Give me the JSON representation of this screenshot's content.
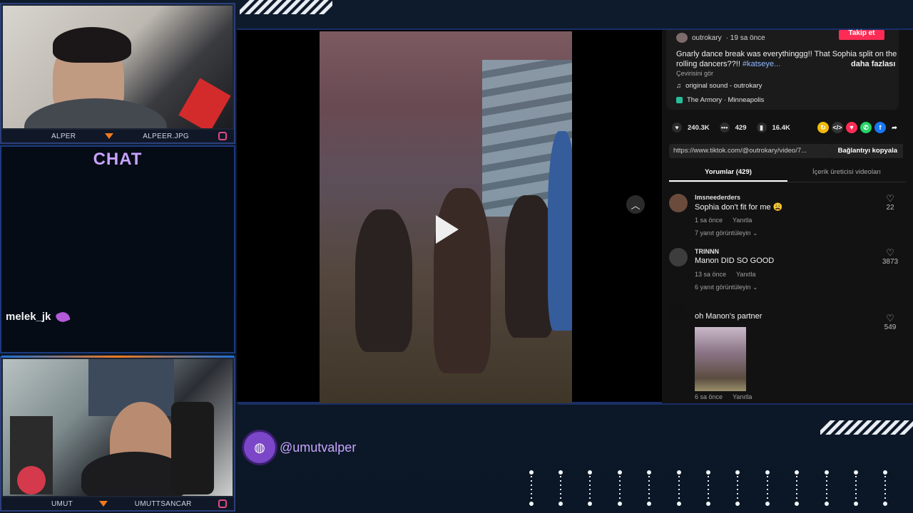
{
  "overlay": {
    "cam_top": {
      "left_name": "ALPER",
      "right_name": "ALPEER.JPG"
    },
    "cam_bottom": {
      "left_name": "UMUT",
      "right_name": "UMUTTSANCAR"
    },
    "chat": {
      "title": "CHAT",
      "message_user": "melek_jk"
    },
    "handle": "@umutvalper"
  },
  "tiktok": {
    "author": "outrokary",
    "posted": "· 19 sa önce",
    "follow_label": "Takip et",
    "caption": "Gnarly dance break was everythinggg!! That Sophia split on the rolling dancers??!! ",
    "caption_tag": "#katseye...",
    "more_label": "daha fazlası",
    "translate_label": "Çevirisini gör",
    "sound": "original sound - outrokary",
    "location": "The Armory · Minneapolis",
    "likes": "240.3K",
    "comments_count": "429",
    "saves": "16.4K",
    "link": "https://www.tiktok.com/@outrokary/video/7...",
    "copy_label": "Bağlantıyı kopyala",
    "tabs": [
      "Yorumlar (429)",
      "İçerik üreticisi videoları"
    ],
    "comments": [
      {
        "user": "lmsneederders",
        "text": "Sophia don't fit for me 😩",
        "time": "1 sa önce",
        "reply": "Yanıtla",
        "replies": "7 yanıt görüntüleyin ⌄",
        "likes": "22"
      },
      {
        "user": "TRINNN",
        "text": "Manon DID SO GOOD",
        "time": "13 sa önce",
        "reply": "Yanıtla",
        "replies": "6 yanıt görüntüleyin ⌄",
        "likes": "3873"
      },
      {
        "user": "",
        "text": "oh Manon's partner",
        "time": "6 sa önce",
        "reply": "Yanıtla",
        "replies": "",
        "likes": "549"
      }
    ]
  }
}
